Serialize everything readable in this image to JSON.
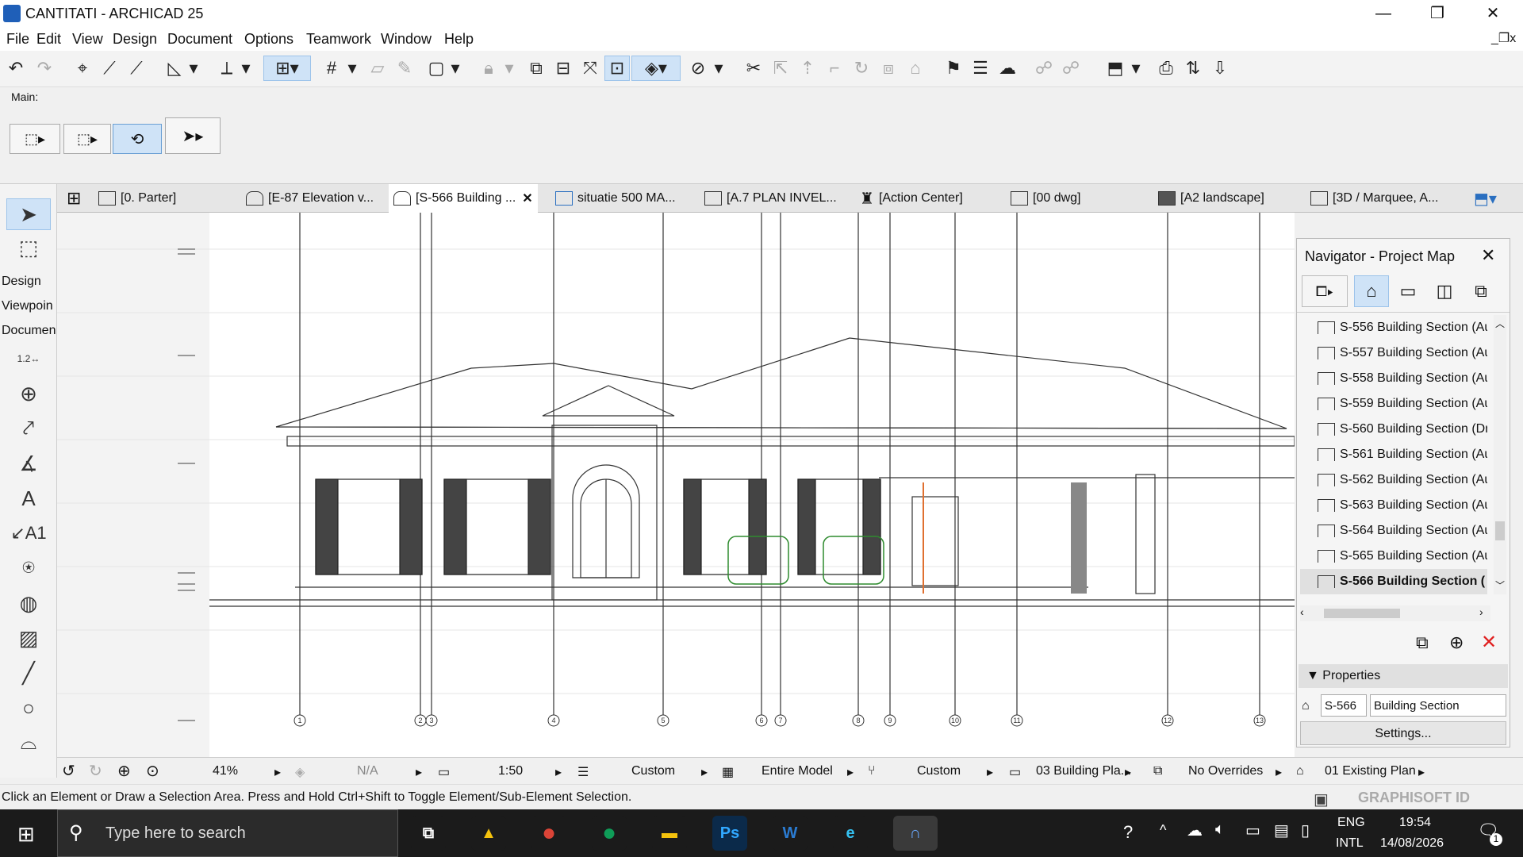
{
  "window": {
    "title": "CANTITATI - ARCHICAD 25",
    "minimize_glyph": "—",
    "restore_glyph": "❐",
    "close_glyph": "✕"
  },
  "menu": [
    "File",
    "Edit",
    "View",
    "Design",
    "Document",
    "Options",
    "Teamwork",
    "Window",
    "Help"
  ],
  "main_label": "Main:",
  "tabs": [
    {
      "label": "[0. Parter]",
      "active": false
    },
    {
      "label": "[E-87 Elevation v...",
      "active": false
    },
    {
      "label": "[S-566 Building ...",
      "active": true
    },
    {
      "label": "situatie 500 MA...",
      "active": false
    },
    {
      "label": "[A.7 PLAN INVEL...",
      "active": false
    },
    {
      "label": "[Action Center]",
      "active": false
    },
    {
      "label": "[00  dwg]",
      "active": false
    },
    {
      "label": "[A2 landscape]",
      "active": false
    },
    {
      "label": "[3D / Marquee, A...",
      "active": false
    }
  ],
  "toolbox": {
    "sections": [
      "Design",
      "Viewpoin",
      "Documen"
    ],
    "dim_label": "1.2",
    "text_label": "A",
    "label_tool": "A1"
  },
  "navigator": {
    "title": "Navigator - Project Map",
    "items": [
      {
        "label": "S-556 Building Section (Au",
        "selected": false
      },
      {
        "label": "S-557 Building Section (Au",
        "selected": false
      },
      {
        "label": "S-558 Building Section (Au",
        "selected": false
      },
      {
        "label": "S-559 Building Section (Au",
        "selected": false
      },
      {
        "label": "S-560 Building Section (Dr",
        "selected": false
      },
      {
        "label": "S-561 Building Section (Au",
        "selected": false
      },
      {
        "label": "S-562 Building Section (Au",
        "selected": false
      },
      {
        "label": "S-563 Building Section (Au",
        "selected": false
      },
      {
        "label": "S-564 Building Section (Au",
        "selected": false
      },
      {
        "label": "S-565 Building Section (Au",
        "selected": false
      },
      {
        "label": "S-566 Building Section (",
        "selected": true
      }
    ],
    "properties_label": "Properties",
    "id_value": "S-566",
    "name_value": "Building Section",
    "settings_label": "Settings..."
  },
  "grid_markers": [
    "1",
    "2",
    "3",
    "4",
    "5",
    "6",
    "7",
    "8",
    "9",
    "10",
    "11",
    "12",
    "13"
  ],
  "quick_options": {
    "zoom": "41%",
    "angle": "N/A",
    "scale": "1:50",
    "layer_combo": "Custom",
    "model_view": "Entire Model",
    "pen_set": "Custom",
    "dimension": "03 Building Pla...",
    "overrides": "No Overrides",
    "renovation": "01 Existing Plan"
  },
  "status": {
    "hint": "Click an Element or Draw a Selection Area. Press and Hold Ctrl+Shift to Toggle Element/Sub-Element Selection.",
    "brand": "GRAPHISOFT ID"
  },
  "taskbar": {
    "search_placeholder": "Type here to search",
    "lang_top": "ENG",
    "lang_bottom": "INTL",
    "time": "19:54",
    "date": "14/08/2026",
    "notification_count": "1",
    "apps": [
      {
        "name": "task-view",
        "glyph": "⧉",
        "color": "#1b1b1b"
      },
      {
        "name": "google-drive",
        "glyph": "▲",
        "color": "#1b1b1b"
      },
      {
        "name": "chrome",
        "glyph": "●",
        "color": "#1b1b1b"
      },
      {
        "name": "chrome-profile",
        "glyph": "●",
        "color": "#1b1b1b"
      },
      {
        "name": "file-explorer",
        "glyph": "▬",
        "color": "#1b1b1b"
      },
      {
        "name": "photoshop",
        "glyph": "Ps",
        "color": "#0b2a4a"
      },
      {
        "name": "word",
        "glyph": "W",
        "color": "#1b1b1b"
      },
      {
        "name": "edge",
        "glyph": "e",
        "color": "#1b1b1b"
      },
      {
        "name": "archicad",
        "glyph": "∩",
        "color": "#3a3a3a"
      }
    ]
  }
}
